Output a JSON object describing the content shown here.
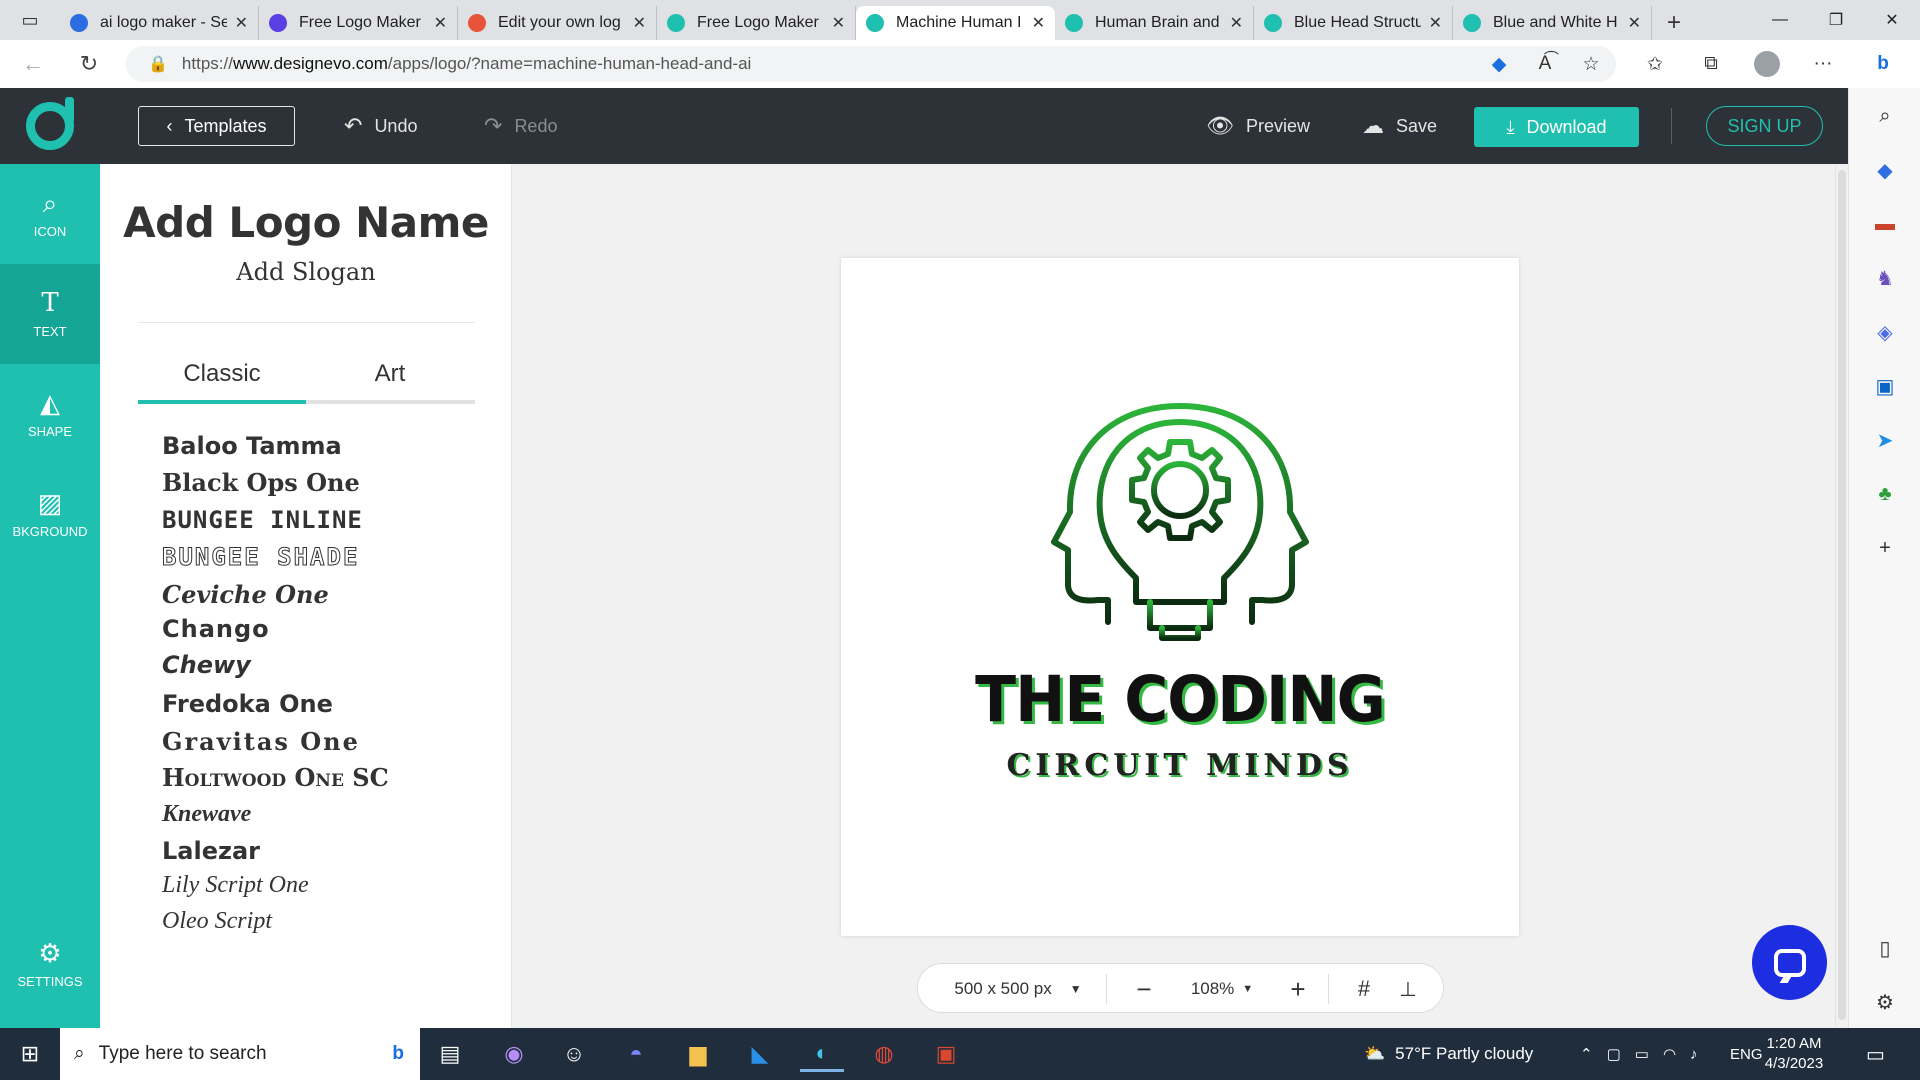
{
  "browser": {
    "tabs": [
      {
        "title": "ai logo maker - Se",
        "icon": "search-icon",
        "color": "#2b6de1"
      },
      {
        "title": "Free Logo Maker",
        "icon": "logo-favicon",
        "color": "#5b3fe4"
      },
      {
        "title": "Edit your own log",
        "icon": "logo-favicon",
        "color": "#e8543a"
      },
      {
        "title": "Free Logo Maker",
        "icon": "designevo-favicon",
        "color": "#1fc0b0"
      },
      {
        "title": "Machine Human I",
        "icon": "designevo-favicon",
        "color": "#1fc0b0"
      },
      {
        "title": "Human Brain and",
        "icon": "designevo-favicon",
        "color": "#1fc0b0"
      },
      {
        "title": "Blue Head Structu",
        "icon": "designevo-favicon",
        "color": "#1fc0b0"
      },
      {
        "title": "Blue and White H",
        "icon": "designevo-favicon",
        "color": "#1fc0b0"
      }
    ],
    "active_tab": 4,
    "url_prefix": "https://",
    "url_host": "www.designevo.com",
    "url_path": "/apps/logo/?name=machine-human-head-and-ai"
  },
  "header": {
    "templates_label": "Templates",
    "undo_label": "Undo",
    "redo_label": "Redo",
    "preview_label": "Preview",
    "save_label": "Save",
    "download_label": "Download",
    "signup_label": "SIGN UP"
  },
  "leftnav": {
    "icon_label": "ICON",
    "text_label": "TEXT",
    "shape_label": "SHAPE",
    "background_label": "BKGROUND",
    "settings_label": "SETTINGS"
  },
  "panel": {
    "add_name": "Add Logo Name",
    "add_slogan": "Add Slogan",
    "tab_classic": "Classic",
    "tab_art": "Art",
    "fonts": [
      "Baloo Tamma",
      "Black Ops One",
      "BUNGEE INLINE",
      "BUNGEE SHADE",
      "Ceviche One",
      "Chango",
      "Chewy",
      "Fredoka One",
      "Gravitas One",
      "Holtwood One SC",
      "Knewave",
      "Lalezar",
      "Lily Script One",
      "Oleo Script"
    ]
  },
  "canvas": {
    "logo_title": "THE CODING",
    "logo_subtitle": "CIRCUIT MINDS",
    "accent_color": "#35b944"
  },
  "bottombar": {
    "size_label": "500 x 500 px",
    "zoom_label": "108%"
  },
  "taskbar": {
    "search_placeholder": "Type here to search",
    "weather": "57°F  Partly cloudy",
    "lang": "ENG",
    "time": "1:20 AM",
    "date": "4/3/2023"
  },
  "colors": {
    "brand": "#1fc0b0",
    "header_bg": "#2d3238",
    "chat": "#1d2ee0"
  }
}
